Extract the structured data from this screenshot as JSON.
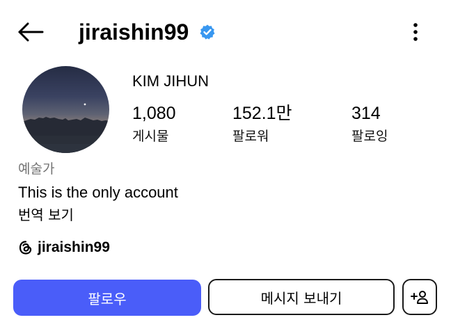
{
  "header": {
    "username": "jiraishin99",
    "back_icon": "arrow-left-icon",
    "verified_icon": "verified-badge-icon",
    "more_icon": "more-vertical-icon"
  },
  "profile": {
    "full_name": "KIM JIHUN",
    "stats": [
      {
        "value": "1,080",
        "label": "게시물"
      },
      {
        "value": "152.1만",
        "label": "팔로워"
      },
      {
        "value": "314",
        "label": "팔로잉"
      }
    ],
    "category": "예술가",
    "bio": "This is the only account",
    "translate_label": "번역 보기",
    "threads_handle": "jiraishin99",
    "threads_icon": "threads-icon"
  },
  "actions": {
    "follow_label": "팔로우",
    "message_label": "메시지 보내기",
    "suggest_icon": "add-person-icon"
  },
  "colors": {
    "accent": "#4a5df9",
    "verified": "#3897f0",
    "muted_text": "#737373"
  }
}
